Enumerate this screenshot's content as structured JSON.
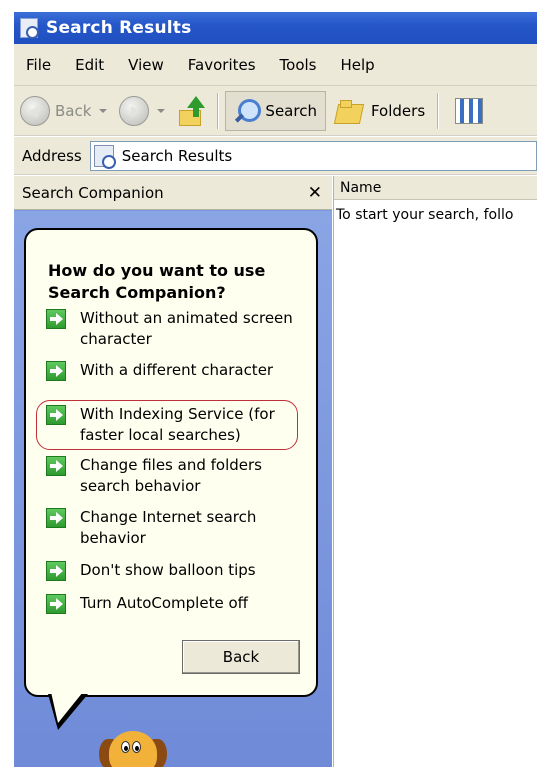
{
  "window": {
    "title": "Search Results"
  },
  "menu": {
    "items": [
      "File",
      "Edit",
      "View",
      "Favorites",
      "Tools",
      "Help"
    ]
  },
  "toolbar": {
    "back_label": "Back",
    "search_label": "Search",
    "folders_label": "Folders"
  },
  "address": {
    "label": "Address",
    "value": "Search Results"
  },
  "search_companion": {
    "title": "Search Companion",
    "heading": "How do you want to use Search Companion?",
    "options": [
      "Without an animated screen character",
      "With a different character",
      "With Indexing Service (for faster local searches)",
      "Change files and folders search behavior",
      "Change Internet search behavior",
      "Don't show balloon tips",
      "Turn AutoComplete off"
    ],
    "back_button": "Back"
  },
  "results": {
    "column_name": "Name",
    "hint": "To start your search, follo"
  },
  "icons": {
    "title": "search-results-window-icon",
    "back": "back-arrow-icon",
    "forward": "forward-arrow-icon",
    "up": "up-folder-icon",
    "search": "magnifier-icon",
    "folders": "folders-icon",
    "views": "views-icon",
    "option": "green-arrow-icon",
    "character": "dog-character-icon"
  },
  "colors": {
    "titlebar": "#2657c9",
    "chrome": "#ece9d8",
    "pane": "#7a96df",
    "balloon": "#fffff0",
    "highlight": "#c0303a",
    "option_arrow": "#2f9b2f"
  }
}
